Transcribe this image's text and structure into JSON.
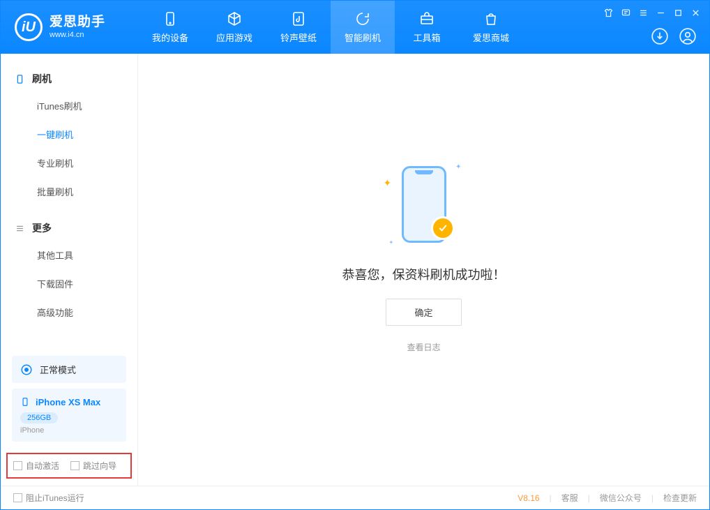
{
  "app": {
    "title": "爱思助手",
    "subtitle": "www.i4.cn"
  },
  "tabs": {
    "device": "我的设备",
    "apps": "应用游戏",
    "ringtone": "铃声壁纸",
    "flash": "智能刷机",
    "toolbox": "工具箱",
    "store": "爱思商城"
  },
  "sidebar": {
    "group_flash": "刷机",
    "items_flash": {
      "itunes": "iTunes刷机",
      "onekey": "一键刷机",
      "pro": "专业刷机",
      "batch": "批量刷机"
    },
    "group_more": "更多",
    "items_more": {
      "other": "其他工具",
      "firmware": "下载固件",
      "advanced": "高级功能"
    }
  },
  "mode": {
    "label": "正常模式"
  },
  "device": {
    "name": "iPhone XS Max",
    "capacity": "256GB",
    "line": "iPhone"
  },
  "checks": {
    "auto_activate": "自动激活",
    "skip_guide": "跳过向导"
  },
  "main": {
    "success": "恭喜您，保资料刷机成功啦！",
    "confirm": "确定",
    "view_log": "查看日志"
  },
  "footer": {
    "block_itunes": "阻止iTunes运行",
    "version": "V8.16",
    "support": "客服",
    "wechat": "微信公众号",
    "update": "检查更新"
  }
}
